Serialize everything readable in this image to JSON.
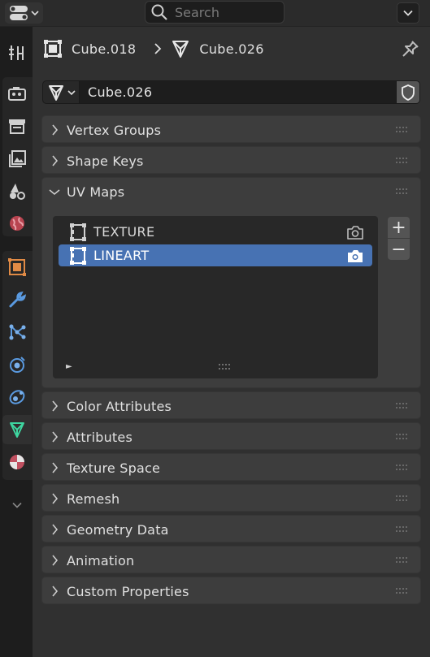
{
  "header": {
    "search_placeholder": "Search"
  },
  "breadcrumb": {
    "object_name": "Cube.018",
    "mesh_name": "Cube.026"
  },
  "datablock": {
    "name": "Cube.026"
  },
  "panels": {
    "vertex_groups": "Vertex Groups",
    "shape_keys": "Shape Keys",
    "uv_maps": "UV Maps",
    "color_attributes": "Color Attributes",
    "attributes": "Attributes",
    "texture_space": "Texture Space",
    "remesh": "Remesh",
    "geometry_data": "Geometry Data",
    "animation": "Animation",
    "custom_properties": "Custom Properties"
  },
  "uv_maps": {
    "items": [
      {
        "name": "TEXTURE",
        "selected": false
      },
      {
        "name": "LINEART",
        "selected": true
      }
    ],
    "add_label": "+",
    "remove_label": "−"
  },
  "colors": {
    "accent_selected": "#4772b3",
    "active_tab_icon": "#3ed6a0"
  },
  "tabs": [
    "tool",
    "render",
    "output",
    "view-layer",
    "scene",
    "world",
    "object",
    "modifiers",
    "particles",
    "physics",
    "constraints",
    "data",
    "material"
  ],
  "active_tab": "data"
}
